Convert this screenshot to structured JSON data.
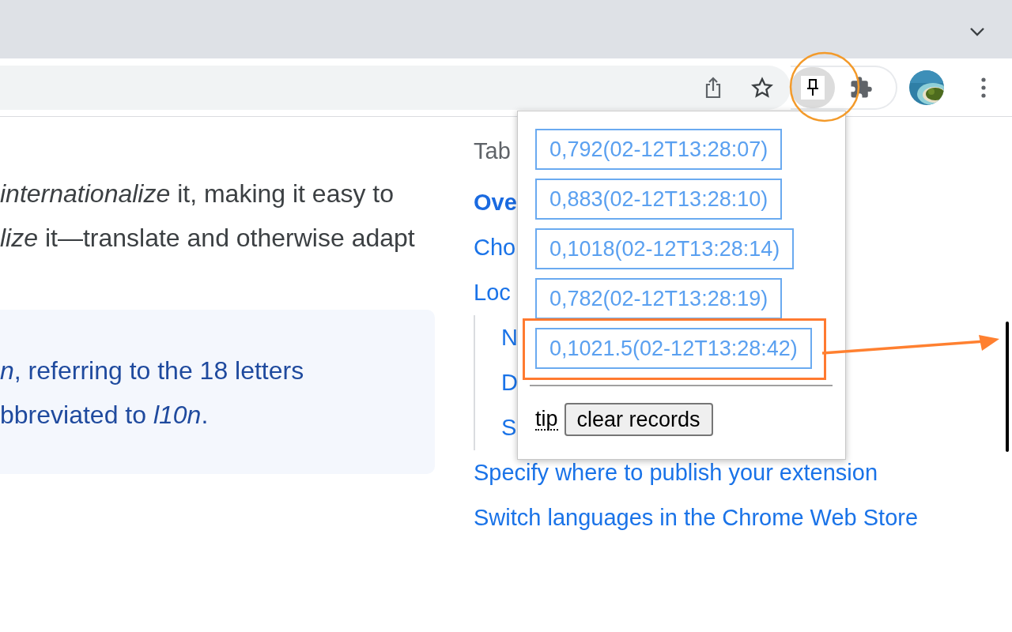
{
  "article": {
    "paragraph": [
      "*internationalize* it, making it easy to",
      "*lize* it—translate and otherwise adapt"
    ],
    "callout": [
      "*n*, referring to the 18 letters",
      "bbreviated to *l10n*."
    ]
  },
  "toc": {
    "title": "Tab",
    "items": [
      {
        "label": "Ove",
        "selected": true
      },
      {
        "label": "Cho",
        "selected": false
      },
      {
        "label": "Loc",
        "selected": false,
        "children": [
          {
            "label": "N",
            "selected": false
          },
          {
            "label": "D",
            "selected": false
          },
          {
            "label": "S",
            "selected": false
          }
        ]
      },
      {
        "label": "Specify where to publish your extension",
        "selected": false
      },
      {
        "label": "Switch languages in the Chrome Web Store",
        "selected": false
      }
    ]
  },
  "popup": {
    "records": [
      {
        "label": "0,792(02-12T13:28:07)",
        "highlighted": false
      },
      {
        "label": "0,883(02-12T13:28:10)",
        "highlighted": false
      },
      {
        "label": "0,1018(02-12T13:28:14)",
        "highlighted": false
      },
      {
        "label": "0,782(02-12T13:28:19)",
        "highlighted": false
      },
      {
        "label": "0,1021.5(02-12T13:28:42)",
        "highlighted": true
      }
    ],
    "tip": "tip",
    "button": "clear records"
  }
}
